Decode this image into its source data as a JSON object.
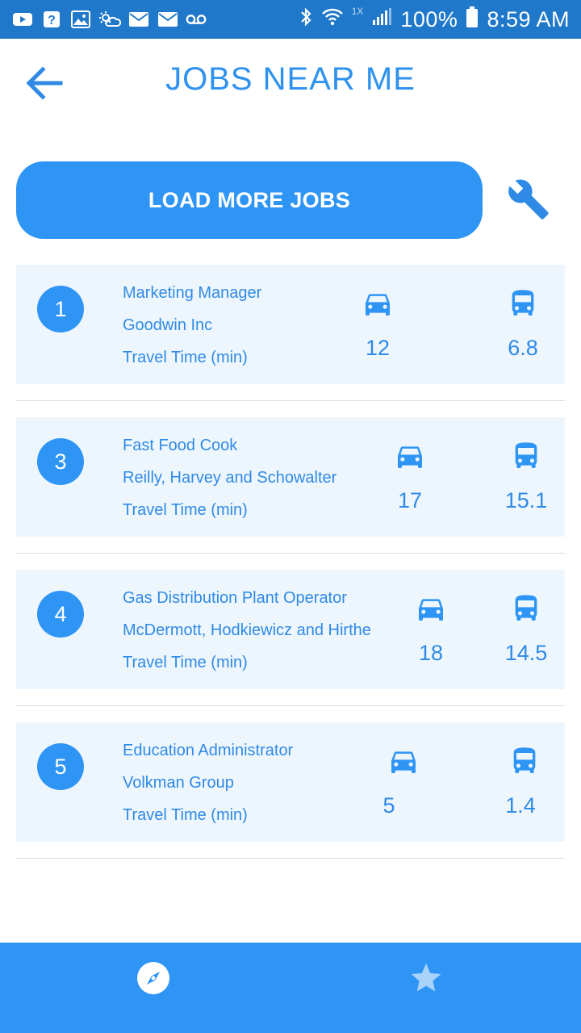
{
  "status_bar": {
    "battery": "100%",
    "time": "8:59 AM",
    "network_badge": "1X"
  },
  "header": {
    "title": "JOBS NEAR ME"
  },
  "actions": {
    "load_more_label": "LOAD MORE JOBS"
  },
  "jobs": [
    {
      "rank": "1",
      "title": "Marketing Manager",
      "company": "Goodwin Inc",
      "travel_label": "Travel Time (min)",
      "car_time": "12",
      "bus_time": "6.8"
    },
    {
      "rank": "3",
      "title": "Fast Food Cook",
      "company": "Reilly, Harvey and Schowalter",
      "travel_label": "Travel Time (min)",
      "car_time": "17",
      "bus_time": "15.1"
    },
    {
      "rank": "4",
      "title": "Gas Distribution Plant Operator",
      "company": "McDermott, Hodkiewicz and Hirthe",
      "travel_label": "Travel Time (min)",
      "car_time": "18",
      "bus_time": "14.5"
    },
    {
      "rank": "5",
      "title": "Education Administrator",
      "company": "Volkman Group",
      "travel_label": "Travel Time (min)",
      "car_time": "5",
      "bus_time": "1.4"
    }
  ],
  "bottom_nav": {
    "items": [
      "compass-icon",
      "star-icon"
    ]
  },
  "colors": {
    "accent": "#2f95f5",
    "status_bar": "#1f78c9",
    "card_bg": "#eef6fd",
    "text_blue": "#2f8ae6"
  }
}
